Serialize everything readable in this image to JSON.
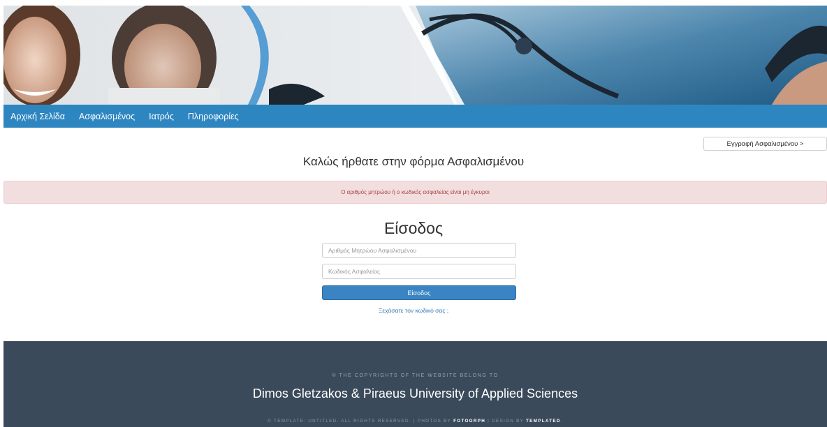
{
  "nav": {
    "items": [
      "Αρχική Σελίδα",
      "Ασφαλισμένος",
      "Ιατρός",
      "Πληροφορίες"
    ]
  },
  "register_button": "Εγγραφή Ασφαλισμένου >",
  "welcome_title": "Καλώς ήρθατε στην φόρμα Ασφαλισμένου",
  "alert_message": "Ο αριθμός μητρώου ή ο κωδικός ασφαλείας είναι μη έγκυροι",
  "login": {
    "title": "Είσοδος",
    "id_placeholder": "Αριθμός Μητρώου Ασφαλισμένου",
    "password_placeholder": "Κωδικός Ασφαλείας",
    "submit_label": "Είσοδος",
    "forgot_link": "Ξεχάσατε τον κωδικό σας ;"
  },
  "footer": {
    "copyright_line": "© THE COPYRIGHTS OF THE WEBSITE BELONG TO",
    "owner": "Dimos Gletzakos & Piraeus University of Applied Sciences",
    "credits_prefix": "© TEMPLATE: UNTITLED. ALL RIGHTS RESERVED. | PHOTOS BY ",
    "photos_by": "FOTOGRPH",
    "credits_mid": " | DESIGN BY ",
    "design_by": "TEMPLATED",
    "credits_suffix": "."
  },
  "colors": {
    "nav_bg": "#2e86c1",
    "alert_bg": "#f2dede",
    "alert_text": "#a94442",
    "button_bg": "#3a84c3",
    "footer_bg": "#3a4a5a"
  }
}
